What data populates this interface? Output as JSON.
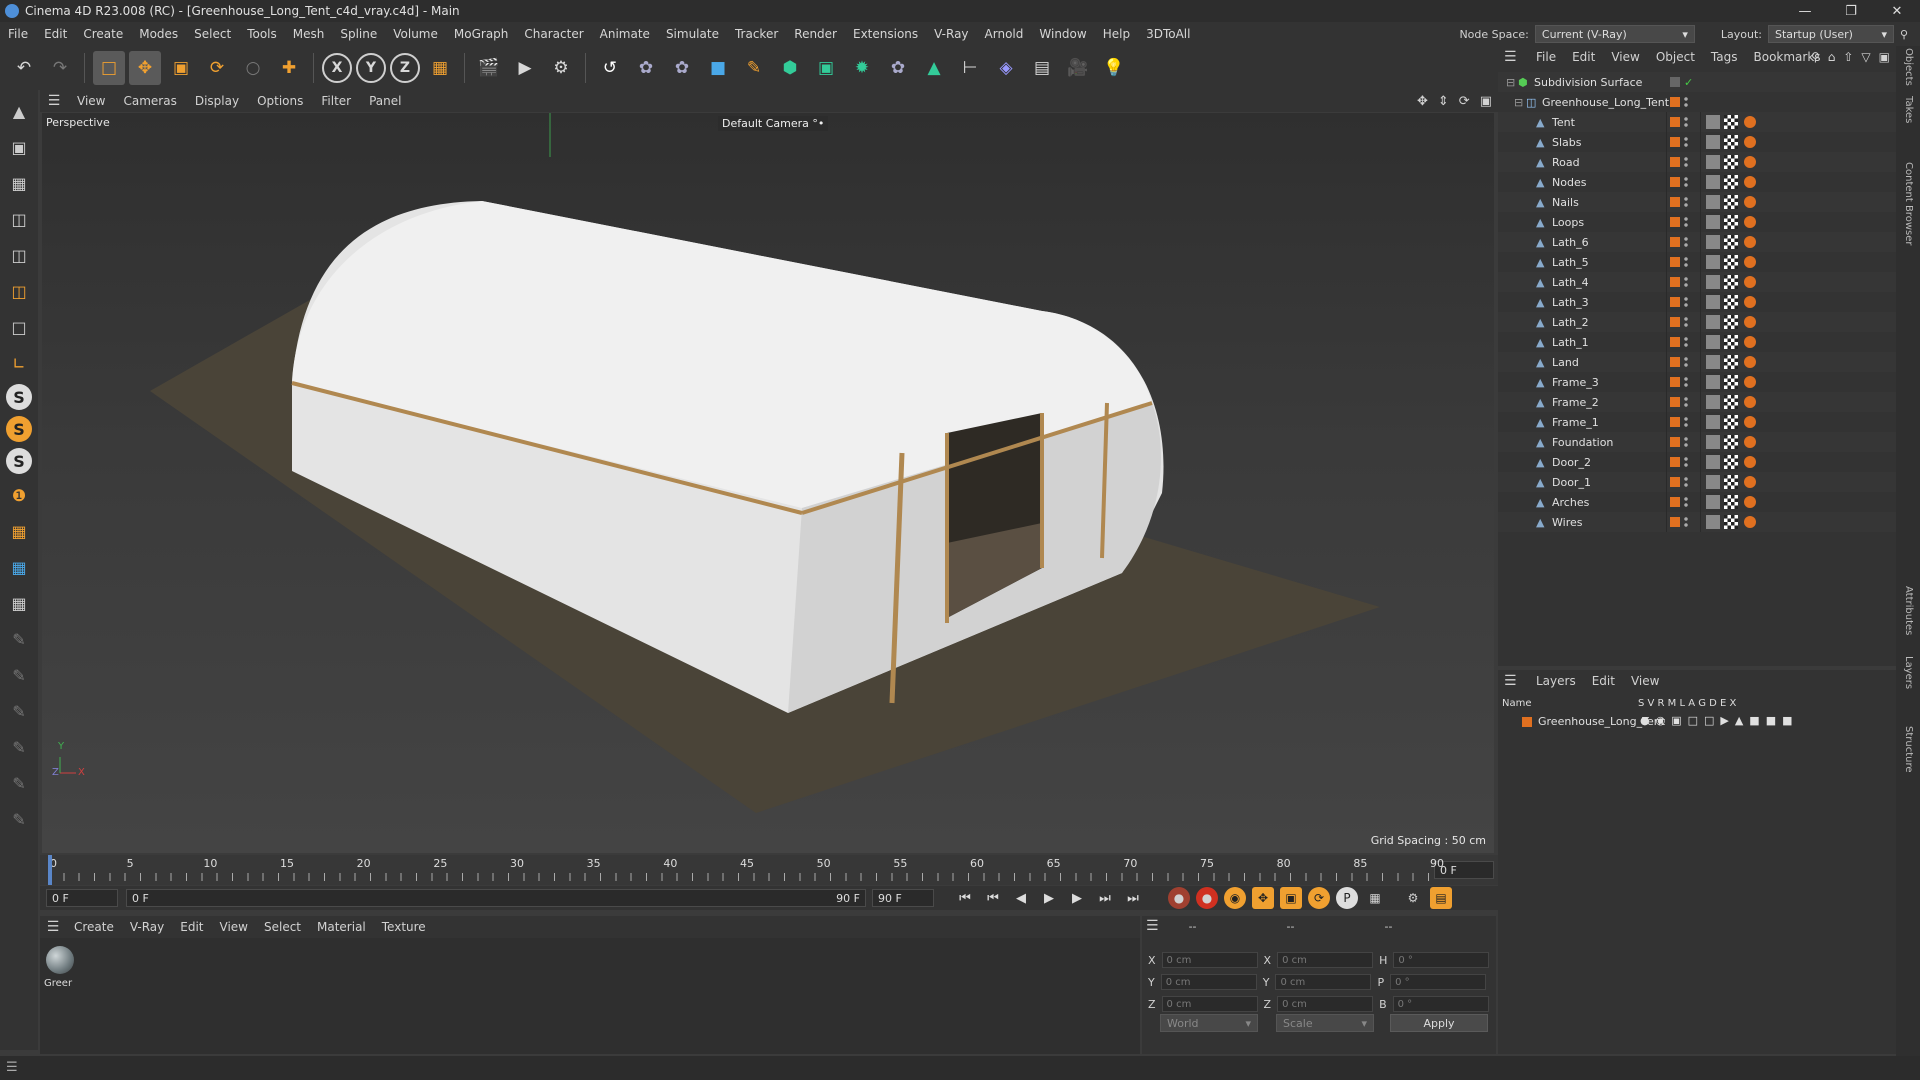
{
  "app": {
    "title": "Cinema 4D R23.008 (RC) - [Greenhouse_Long_Tent_c4d_vray.c4d] - Main"
  },
  "menu": [
    "File",
    "Edit",
    "Create",
    "Modes",
    "Select",
    "Tools",
    "Mesh",
    "Spline",
    "Volume",
    "MoGraph",
    "Character",
    "Animate",
    "Simulate",
    "Tracker",
    "Render",
    "Extensions",
    "V-Ray",
    "Arnold",
    "Window",
    "Help",
    "3DToAll"
  ],
  "nodespace": {
    "label": "Node Space:",
    "value": "Current (V-Ray)"
  },
  "layout": {
    "label": "Layout:",
    "value": "Startup (User)"
  },
  "viewport": {
    "menu": [
      "View",
      "Cameras",
      "Display",
      "Options",
      "Filter",
      "Panel"
    ],
    "label": "Perspective",
    "camera": "Default Camera °•",
    "grid": "Grid Spacing : 50 cm",
    "axes": {
      "x": "X",
      "y": "Y",
      "z": "Z"
    }
  },
  "timeline": {
    "ticks": [
      "0",
      "5",
      "10",
      "15",
      "20",
      "25",
      "30",
      "35",
      "40",
      "45",
      "50",
      "55",
      "60",
      "65",
      "70",
      "75",
      "80",
      "85",
      "90"
    ],
    "frame_right": "0 F"
  },
  "playbar": {
    "start": "0 F",
    "cur": "0 F",
    "end_inner": "90 F",
    "end": "90 F"
  },
  "materials": {
    "menu": [
      "Create",
      "V-Ray",
      "Edit",
      "View",
      "Select",
      "Material",
      "Texture"
    ],
    "item": "Greer"
  },
  "coords": {
    "x_label": "X",
    "y_label": "Y",
    "z_label": "Z",
    "h_label": "H",
    "p_label": "P",
    "b_label": "B",
    "pos": "0 cm",
    "size": "0 cm",
    "rot": "0 °",
    "dash1": "--",
    "dash2": "--",
    "dash3": "--",
    "world": "World",
    "scale": "Scale",
    "apply": "Apply"
  },
  "objects": {
    "menu": [
      "File",
      "Edit",
      "View",
      "Object",
      "Tags",
      "Bookmarks"
    ],
    "root": "Subdivision Surface",
    "group": "Greenhouse_Long_Tent",
    "items": [
      "Tent",
      "Slabs",
      "Road",
      "Nodes",
      "Nails",
      "Loops",
      "Lath_6",
      "Lath_5",
      "Lath_4",
      "Lath_3",
      "Lath_2",
      "Lath_1",
      "Land",
      "Frame_3",
      "Frame_2",
      "Frame_1",
      "Foundation",
      "Door_2",
      "Door_1",
      "Arches",
      "Wires"
    ]
  },
  "layers": {
    "menu": [
      "Layers",
      "Edit",
      "View"
    ],
    "col_name": "Name",
    "cols": "S  V  R  M  L  A  G  D  E  X",
    "row": "Greenhouse_Long_Tent"
  },
  "side_tabs": [
    "Objects",
    "Takes",
    "Content Browser",
    "Attributes",
    "Layers",
    "Structure"
  ]
}
